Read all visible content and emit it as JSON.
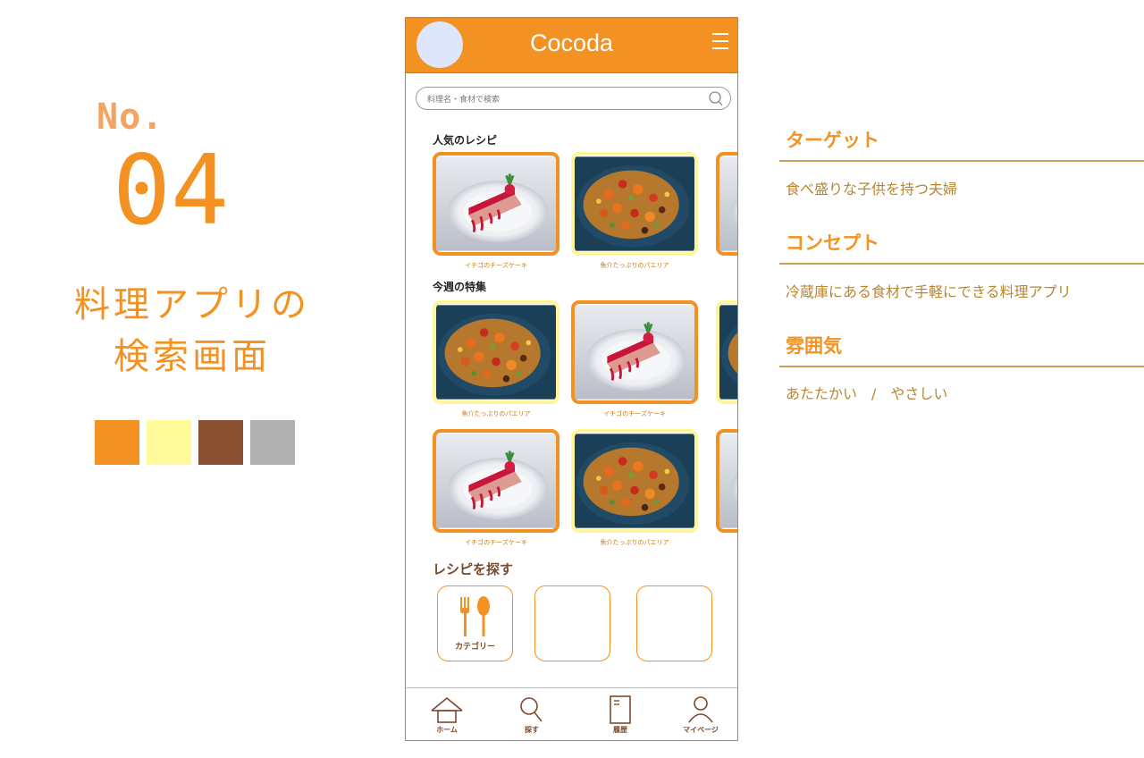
{
  "page": {
    "no_label": "No.",
    "number": "04",
    "title_line1": "料理アプリの",
    "title_line2": "検索画面",
    "swatches": [
      "#F39222",
      "#FFFA9A",
      "#8A5232",
      "#B1B1B1"
    ]
  },
  "app": {
    "title": "Cocoda",
    "search_placeholder": "料理名・食材で検索",
    "popular_title": "人気のレシピ",
    "feature_title": "今週の特集",
    "popular_captions": [
      "イチゴのチーズケーキ",
      "魚介たっぷりのパエリア"
    ],
    "feature_row1_captions": [
      "魚介たっぷりのパエリア",
      "イチゴのチーズケーキ"
    ],
    "feature_row2_captions": [
      "イチゴのチーズケーキ",
      "魚介たっぷりのパエリア"
    ],
    "explore_title": "レシピを探す",
    "category_label": "カテゴリー",
    "nav": {
      "home": "ホーム",
      "search": "探す",
      "history": "履歴",
      "mypage": "マイページ"
    }
  },
  "info": {
    "target_heading": "ターゲット",
    "target_text": "食べ盛りな子供を持つ夫婦",
    "concept_heading": "コンセプト",
    "concept_text": "冷蔵庫にある食材で手軽にできる料理アプリ",
    "mood_heading": "雰囲気",
    "mood_text": "あたたかい　/　やさしい"
  }
}
